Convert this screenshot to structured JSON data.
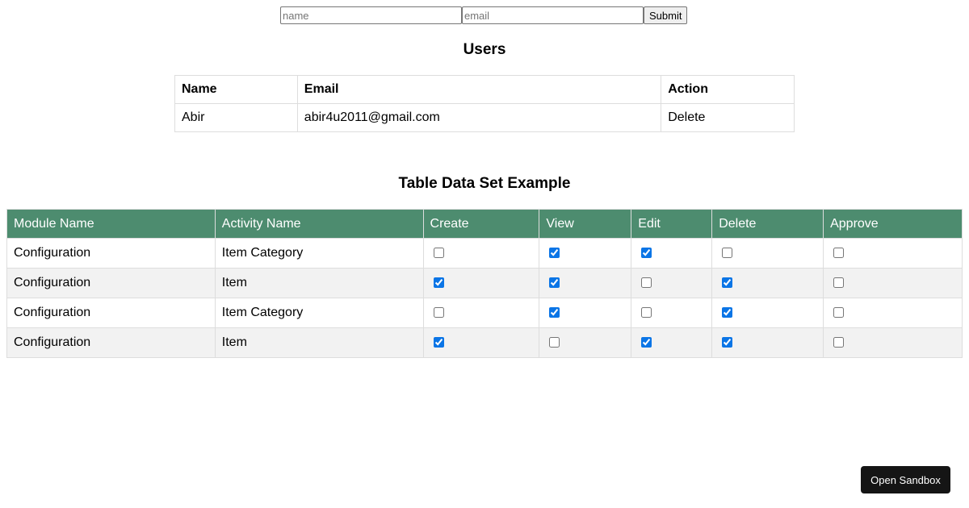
{
  "form": {
    "name_placeholder": "name",
    "email_placeholder": "email",
    "submit_label": "Submit"
  },
  "users": {
    "title": "Users",
    "headers": [
      "Name",
      "Email",
      "Action"
    ],
    "rows": [
      {
        "name": "Abir",
        "email": "abir4u2011@gmail.com",
        "action": "Delete"
      }
    ]
  },
  "permissions": {
    "title": "Table Data Set Example",
    "headers": [
      "Module Name",
      "Activity Name",
      "Create",
      "View",
      "Edit",
      "Delete",
      "Approve"
    ],
    "rows": [
      {
        "module": "Configuration",
        "activity": "Item Category",
        "create": false,
        "view": true,
        "edit": true,
        "delete": false,
        "approve": false
      },
      {
        "module": "Configuration",
        "activity": "Item",
        "create": true,
        "view": true,
        "edit": false,
        "delete": true,
        "approve": false
      },
      {
        "module": "Configuration",
        "activity": "Item Category",
        "create": false,
        "view": true,
        "edit": false,
        "delete": true,
        "approve": false
      },
      {
        "module": "Configuration",
        "activity": "Item",
        "create": true,
        "view": false,
        "edit": true,
        "delete": true,
        "approve": false
      }
    ]
  },
  "sandbox": {
    "button_label": "Open Sandbox"
  },
  "colors": {
    "header_bg": "#4d8c6f",
    "checkbox_accent": "#0b75e6",
    "sandbox_bg": "#151515"
  }
}
